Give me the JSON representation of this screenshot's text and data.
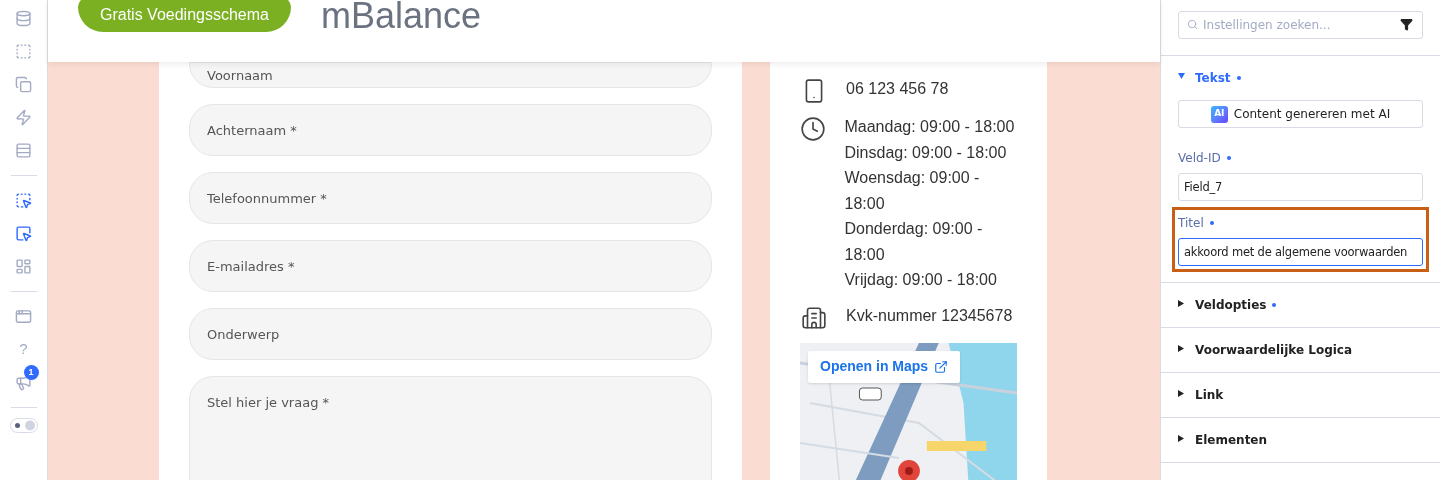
{
  "rail": {
    "groups": [
      [
        {
          "active": false
        },
        {
          "active": false
        },
        {
          "active": false
        },
        {
          "active": false
        },
        {
          "active": false
        }
      ],
      [
        {
          "active": true
        },
        {
          "active": true
        },
        {
          "active": false
        }
      ],
      [
        {
          "active": false
        },
        {
          "active": false,
          "label": "?"
        },
        {
          "active": false,
          "badge": "1"
        }
      ]
    ]
  },
  "header": {
    "cta": "Gratis Voedingsschema",
    "logo": "mBalance"
  },
  "form": {
    "fields": [
      {
        "kind": "input",
        "placeholder": "Voornaam"
      },
      {
        "kind": "input",
        "placeholder": "Achternaam *"
      },
      {
        "kind": "input",
        "placeholder": "Telefoonnummer *"
      },
      {
        "kind": "input",
        "placeholder": "E-mailadres *"
      },
      {
        "kind": "input",
        "placeholder": "Onderwerp"
      },
      {
        "kind": "textarea",
        "placeholder": "Stel hier je vraag *"
      }
    ]
  },
  "contact": {
    "items": [
      {
        "lines": [
          "06 123 456 78"
        ]
      },
      {
        "lines": [
          "Maandag: 09:00 - 18:00",
          "Dinsdag: 09:00 - 18:00",
          "Woensdag: 09:00 - 18:00",
          "Donderdag: 09:00 - 18:00",
          "Vrijdag: 09:00 - 18:00"
        ]
      },
      {
        "lines": [
          "Kvk-nummer 12345678"
        ]
      }
    ],
    "map": {
      "open_button": "Openen in Maps"
    }
  },
  "settings": {
    "search": {
      "placeholder": "Instellingen zoeken..."
    },
    "sections": [
      {
        "title": "Tekst",
        "expanded": true,
        "modified": true,
        "ai_button": "Content genereren met AI",
        "ai_badge": "AI",
        "fields": [
          {
            "label": "Veld-ID",
            "modified": true,
            "value": "Field_7",
            "highlighted": false
          },
          {
            "label": "Titel",
            "modified": true,
            "value": "akkoord met de algemene voorwaarden",
            "highlighted": true
          }
        ]
      },
      {
        "title": "Veldopties",
        "expanded": false,
        "modified": true
      },
      {
        "title": "Voorwaardelijke Logica",
        "expanded": false,
        "modified": false
      },
      {
        "title": "Link",
        "expanded": false,
        "modified": false
      },
      {
        "title": "Elementen",
        "expanded": false,
        "modified": false
      }
    ]
  }
}
